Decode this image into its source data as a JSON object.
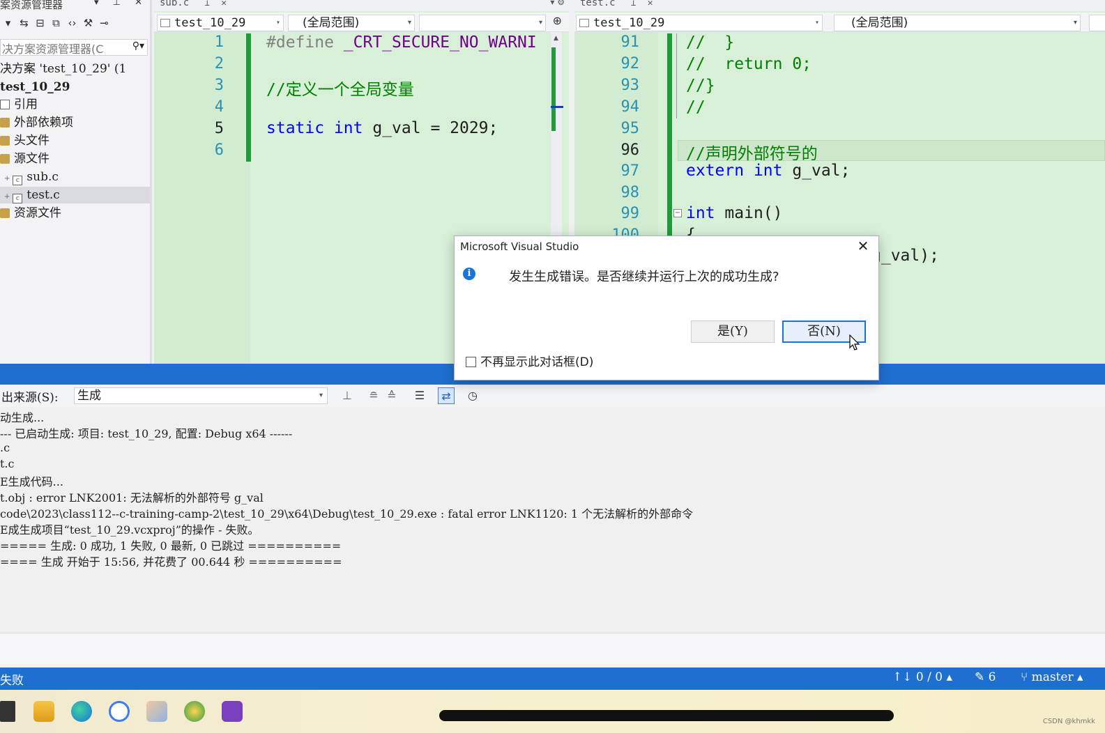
{
  "solution_explorer": {
    "title": "案资源管理器",
    "search_placeholder": "决方案资源管理器(C",
    "items": [
      {
        "label": "决方案 'test_10_29' (1"
      },
      {
        "label": "test_10_29"
      },
      {
        "label": "引用"
      },
      {
        "label": "外部依赖项"
      },
      {
        "label": "头文件"
      },
      {
        "label": "源文件"
      },
      {
        "label": "sub.c"
      },
      {
        "label": "test.c"
      },
      {
        "label": "资源文件"
      }
    ]
  },
  "left_editor": {
    "tab": "sub.c",
    "project": "test_10_29",
    "scope": "(全局范围)",
    "lines": [
      "1",
      "2",
      "3",
      "4",
      "5",
      "6"
    ],
    "current_line": "5",
    "code": {
      "define_kw": "#define",
      "define_macro": "_CRT_SECURE_NO_WARNI",
      "comment": "//定义一个全局变量",
      "static_kw": "static",
      "int_kw": "int",
      "decl_rest": "g_val = 2029;"
    }
  },
  "right_editor": {
    "tab": "test.c",
    "project": "test_10_29",
    "scope": "(全局范围)",
    "lines": [
      "91",
      "92",
      "93",
      "94",
      "95",
      "96",
      "97",
      "98",
      "99",
      "100"
    ],
    "current_line": "96",
    "code": {
      "l91": "//  }",
      "l92": "//  return 0;",
      "l93": "//}",
      "l94": "//",
      "l96": "//声明外部符号的",
      "extern_kw": "extern",
      "int_kw": "int",
      "l97_rest": "g_val;",
      "l99_int": "int",
      "l99_rest": "main()",
      "l100": "{",
      "l101_tail": "g_val);"
    }
  },
  "dialog": {
    "title": "Microsoft Visual Studio",
    "message": "发生生成错误。是否继续并运行上次的成功生成?",
    "yes_label": "是(Y)",
    "no_label": "否(N)",
    "checkbox_label": "不再显示此对话框(D)"
  },
  "output": {
    "source_label": "出来源(S):",
    "source_value": "生成",
    "lines": [
      "动生成...",
      "--- 已启动生成: 项目: test_10_29, 配置: Debug x64 ------",
      ".c",
      "t.c",
      "E生成代码...",
      "t.obj : error LNK2001: 无法解析的外部符号 g_val",
      "code\\2023\\class112--c-training-camp-2\\test_10_29\\x64\\Debug\\test_10_29.exe : fatal error LNK1120: 1 个无法解析的外部命令",
      "E成生成项目“test_10_29.vcxproj”的操作 - 失败。",
      "===== 生成: 0 成功, 1 失败, 0 最新, 0 已跳过 ==========",
      "==== 生成 开始于 15:56, 并花费了 00.644 秒 =========="
    ]
  },
  "status_bar": {
    "status": "失败",
    "sync": "↑↓ 0 / 0 ▴",
    "changes": "✎ 6",
    "branch": "master ▴"
  },
  "watermark": "CSDN @khmkk",
  "colors": {
    "editor_bg": "#d9f0d8",
    "accent_blue": "#1f6fd1",
    "keyword": "#0000ff",
    "comment": "#008000",
    "line_number": "#2b91af"
  }
}
